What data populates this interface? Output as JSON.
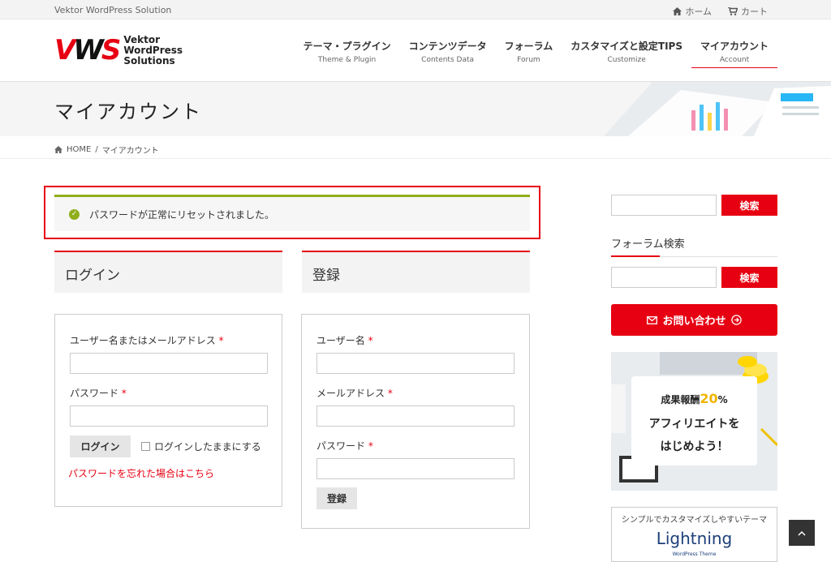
{
  "topbar": {
    "site_name": "Vektor WordPress Solution",
    "home_label": "ホーム",
    "cart_label": "カート"
  },
  "logo": {
    "mark": [
      "V",
      "W",
      "S"
    ],
    "line1": "Vektor",
    "line2": "WordPress",
    "line3": "Solutions"
  },
  "nav": [
    {
      "jp": "テーマ・プラグイン",
      "en": "Theme & Plugin"
    },
    {
      "jp": "コンテンツデータ",
      "en": "Contents Data"
    },
    {
      "jp": "フォーラム",
      "en": "Forum"
    },
    {
      "jp": "カスタマイズと設定TIPS",
      "en": "Customize"
    },
    {
      "jp": "マイアカウント",
      "en": "Account"
    }
  ],
  "page_title": "マイアカウント",
  "breadcrumb": {
    "home": "HOME",
    "sep": "/",
    "current": "マイアカウント"
  },
  "notice": "パスワードが正常にリセットされました。",
  "login": {
    "heading": "ログイン",
    "username_label": "ユーザー名またはメールアドレス",
    "password_label": "パスワード",
    "required_mark": "*",
    "submit": "ログイン",
    "remember": "ログインしたままにする",
    "lost_password": "パスワードを忘れた場合はこちら"
  },
  "register": {
    "heading": "登録",
    "username_label": "ユーザー名",
    "email_label": "メールアドレス",
    "password_label": "パスワード",
    "required_mark": "*",
    "submit": "登録"
  },
  "sidebar": {
    "search_button": "検索",
    "forum_search_heading": "フォーラム検索",
    "forum_search_button": "検索",
    "contact_button": "お問い合わせ",
    "affiliate": {
      "line1_pre": "成果報酬",
      "line1_pct": "20",
      "line1_unit": "%",
      "line2": "アフィリエイトを",
      "line3": "はじめよう！"
    },
    "lightning": {
      "caption": "シンプルでカスタマイズしやすいテーマ",
      "name": "Lightning",
      "subtitle": "WordPress Theme"
    }
  },
  "colors": {
    "accent": "#e60012",
    "success": "#8fae1b"
  }
}
